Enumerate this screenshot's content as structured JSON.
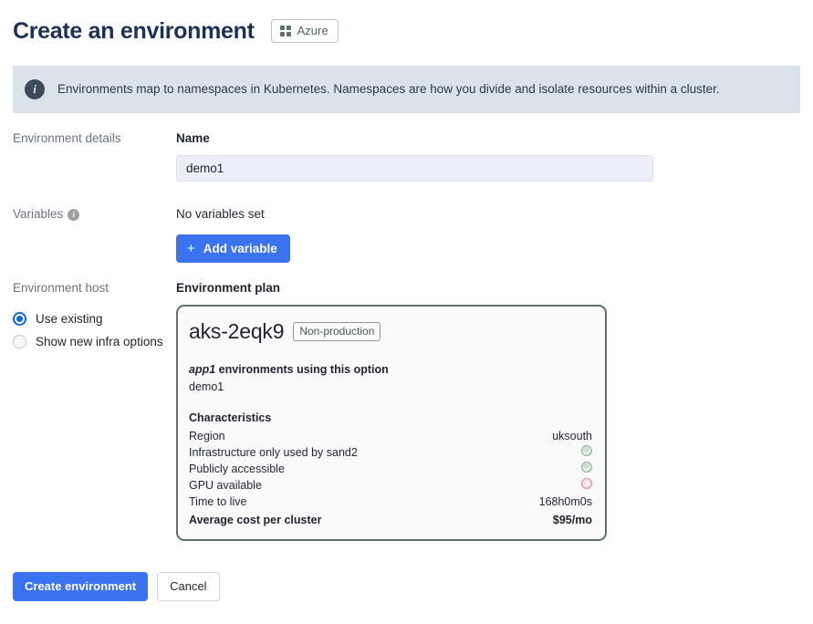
{
  "header": {
    "title": "Create an environment",
    "cloud_badge": {
      "label": "Azure",
      "icon": "grid-icon"
    }
  },
  "banner": {
    "icon": "info-icon",
    "text": "Environments map to namespaces in Kubernetes. Namespaces are how you divide and isolate resources within a cluster."
  },
  "sections": {
    "environment_details": {
      "label": "Environment details",
      "name_label": "Name",
      "name_value": "demo1",
      "name_placeholder": "Name"
    },
    "variables": {
      "label": "Variables",
      "info_icon": "info-icon",
      "empty_text": "No variables set",
      "add_button": "Add variable",
      "add_button_icon": "plus-icon"
    },
    "environment_host": {
      "label": "Environment host",
      "options": [
        {
          "label": "Use existing",
          "selected": true
        },
        {
          "label": "Show new infra options",
          "selected": false
        }
      ]
    }
  },
  "plan": {
    "heading": "Environment plan",
    "name": "aks-2eqk9",
    "tag": "Non-production",
    "usage_app": "app1",
    "usage_suffix": " environments using this option",
    "usage_values": "demo1",
    "characteristics_title": "Characteristics",
    "characteristics": [
      {
        "label": "Region",
        "value": "uksouth",
        "type": "text"
      },
      {
        "label": "Infrastructure only used by sand2",
        "value": "yes",
        "type": "check"
      },
      {
        "label": "Publicly accessible",
        "value": "yes",
        "type": "check"
      },
      {
        "label": "GPU available",
        "value": "no",
        "type": "cross"
      },
      {
        "label": "Time to live",
        "value": "168h0m0s",
        "type": "text"
      }
    ],
    "total": {
      "label": "Average cost per cluster",
      "value": "$95/mo"
    }
  },
  "footer": {
    "create_label": "Create environment",
    "cancel_label": "Cancel"
  },
  "colors": {
    "accent_blue": "#3b72ef",
    "title_navy": "#1d3055",
    "banner_bg": "#dbe3ea",
    "card_border": "#5d716c",
    "ok_green": "#8fb79b",
    "no_red": "#e08a9d"
  }
}
